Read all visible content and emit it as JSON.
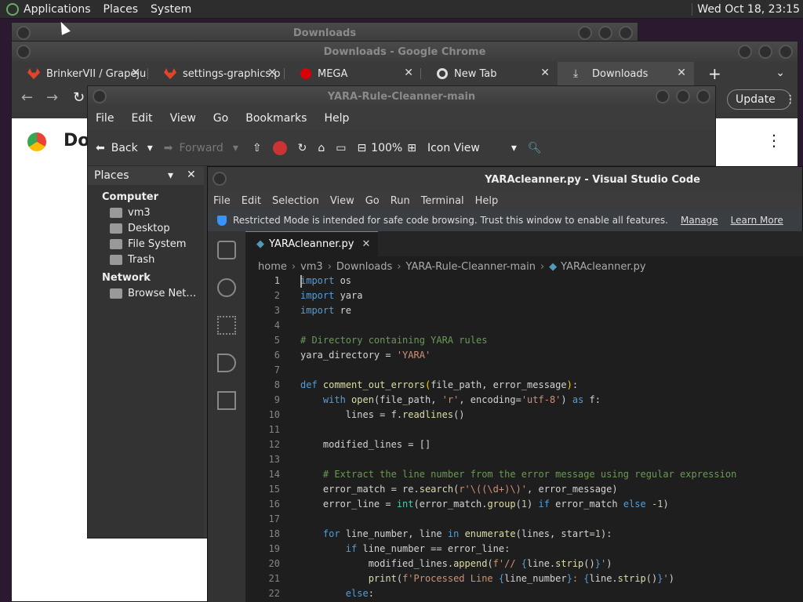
{
  "topbar": {
    "menus": [
      "Applications",
      "Places",
      "System"
    ],
    "clock": "Wed Oct 18, 23:15"
  },
  "downloads_window": {
    "title": "Downloads"
  },
  "chrome": {
    "title": "Downloads - Google Chrome",
    "tabs": [
      {
        "label": "BrinkerVII / Grapeju",
        "icon": "gitlab-icon"
      },
      {
        "label": "settings-graphics.p",
        "icon": "gitlab-icon"
      },
      {
        "label": "MEGA",
        "icon": "mega-icon"
      },
      {
        "label": "New Tab",
        "icon": "chrome-icon"
      },
      {
        "label": "Downloads",
        "icon": "download-icon"
      }
    ],
    "update_label": "Update",
    "page_title_partial": "Dov"
  },
  "file_manager": {
    "title": "YARA-Rule-Cleanner-main",
    "menus": [
      "File",
      "Edit",
      "View",
      "Go",
      "Bookmarks",
      "Help"
    ],
    "toolbar": {
      "back": "Back",
      "forward": "Forward",
      "zoom": "100%",
      "view_mode": "Icon View"
    },
    "places_label": "Places",
    "sections": [
      {
        "title": "Computer",
        "items": [
          "vm3",
          "Desktop",
          "File System",
          "Trash"
        ]
      },
      {
        "title": "Network",
        "items": [
          "Browse Net…"
        ]
      }
    ]
  },
  "vscode": {
    "title": "YARAcleanner.py - Visual Studio Code",
    "menus": [
      "File",
      "Edit",
      "Selection",
      "View",
      "Go",
      "Run",
      "Terminal",
      "Help"
    ],
    "banner": {
      "text": "Restricted Mode is intended for safe code browsing. Trust this window to enable all features.",
      "manage": "Manage",
      "learn_more": "Learn More"
    },
    "tab": "YARAcleanner.py",
    "breadcrumb": [
      "home",
      "vm3",
      "Downloads",
      "YARA-Rule-Cleanner-main",
      "YARAcleanner.py"
    ]
  }
}
